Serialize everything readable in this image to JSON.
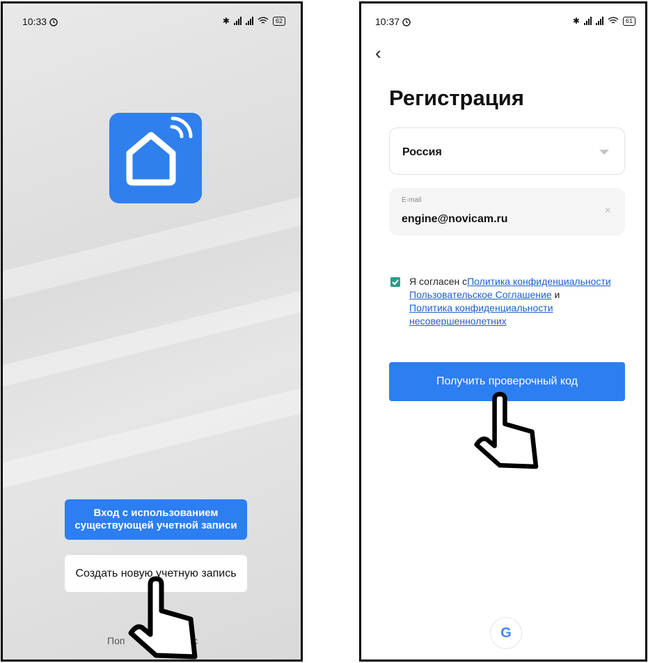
{
  "screen1": {
    "status_time": "10:33",
    "battery": "62",
    "login_line1": "Вход с использованием",
    "login_line2": "существующей учетной записи",
    "create_account": "Создать новую учетную запись",
    "policy_text_start": "Поп",
    "policy_text_end": "ас"
  },
  "screen2": {
    "status_time": "10:37",
    "battery": "61",
    "back_glyph": "‹",
    "title": "Регистрация",
    "country": "Россия",
    "email_label": "E-mail",
    "email_value": "engine@novicam.ru",
    "clear_glyph": "×",
    "agree_prefix": "Я согласен с",
    "link_privacy": "Политика конфиденциальности",
    "link_terms": "Пользовательское Соглашение",
    "and": " и ",
    "link_minors": "Политика конфиденциальности несовершеннолетних",
    "get_code": "Получить проверочный код",
    "google_letter": "G"
  },
  "colors": {
    "brand_blue": "#2f80ed",
    "button_blue": "#2d7ef0",
    "checkbox_green": "#2d9c87",
    "link_blue": "#1a5fd0"
  },
  "icons": [
    "alarm-icon",
    "bluetooth-icon",
    "signal-icon",
    "wifi-icon",
    "battery-icon",
    "smart-home-icon",
    "pointing-hand-icon",
    "google-icon",
    "dropdown-triangle-icon",
    "clear-icon",
    "back-icon",
    "checkbox-icon"
  ]
}
